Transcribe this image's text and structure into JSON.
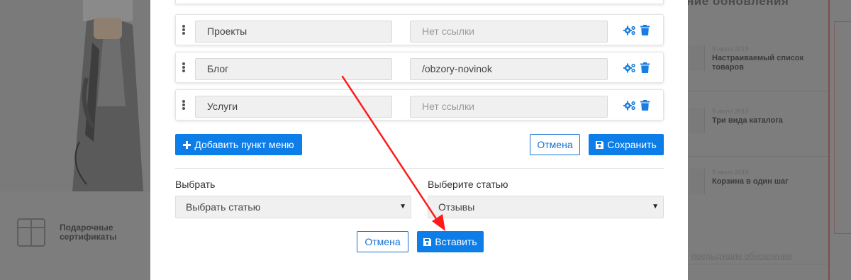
{
  "background": {
    "section_title": "ние обновления",
    "gift": {
      "label_line1": "Подарочные",
      "label_line2": "сертификаты"
    },
    "news": [
      {
        "date": "9 июля 2019",
        "title": "Настраиваемый список товаров"
      },
      {
        "date": "9 июля 2019",
        "title": "Три вида каталога"
      },
      {
        "date": "9 июля 2019",
        "title": "Корзина в один шаг"
      }
    ],
    "bottom_link": "предыдущие обновления"
  },
  "menu": {
    "rows": [
      {
        "name": "Проекты",
        "link": "",
        "link_placeholder": "Нет ссылки"
      },
      {
        "name": "Блог",
        "link": "/obzory-novinok",
        "link_placeholder": "Нет ссылки"
      },
      {
        "name": "Услуги",
        "link": "",
        "link_placeholder": "Нет ссылки"
      }
    ],
    "add_item_label": "Добавить пункт меню",
    "cancel_label": "Отмена",
    "save_label": "Сохранить"
  },
  "insert": {
    "left_label": "Выбрать",
    "left_value": "Выбрать статью",
    "right_label": "Выберите статью",
    "right_value": "Отзывы",
    "cancel_label": "Отмена",
    "insert_label": "Вставить"
  },
  "colors": {
    "primary": "#0d7de8",
    "icon_blue": "#1a7ee0",
    "arrow": "#ff1a1a",
    "overlay": "#7d7d7d"
  },
  "icons": {
    "drag": "drag-handle-icon",
    "settings": "gears-icon",
    "delete": "trash-icon",
    "add": "plus-icon",
    "save": "floppy-disk-icon"
  }
}
